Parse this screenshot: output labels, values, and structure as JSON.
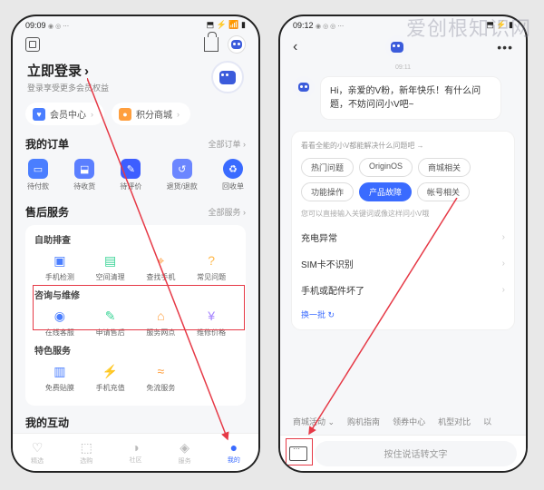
{
  "watermark": "爱创根知识网",
  "phone1": {
    "status": {
      "time": "09:09",
      "icons": "◉ ◎ ⋯",
      "right": "⬒ ⚡ 📶 ▮"
    },
    "login": {
      "title": "立即登录",
      "chevron": "›",
      "subtitle": "登录享受更多会员权益"
    },
    "chips": [
      {
        "icon": "♥",
        "label": "会员中心",
        "chev": "›"
      },
      {
        "icon": "●",
        "label": "积分商城",
        "chev": "›"
      }
    ],
    "orders": {
      "title": "我的订单",
      "link": "全部订单 ›",
      "items": [
        {
          "label": "待付款"
        },
        {
          "label": "待收货"
        },
        {
          "label": "待评价"
        },
        {
          "label": "退货/退款"
        },
        {
          "label": "回收单"
        }
      ]
    },
    "aftersale": {
      "title": "售后服务",
      "link": "全部服务 ›",
      "group1": {
        "title": "自助排查",
        "items": [
          {
            "label": "手机检测"
          },
          {
            "label": "空间清理"
          },
          {
            "label": "查找手机"
          },
          {
            "label": "常见问题"
          }
        ]
      },
      "group2": {
        "title": "咨询与维修",
        "items": [
          {
            "label": "在线客服"
          },
          {
            "label": "申请售后"
          },
          {
            "label": "服务网点"
          },
          {
            "label": "维修价格"
          }
        ]
      },
      "group3": {
        "title": "特色服务",
        "items": [
          {
            "label": "免费贴膜"
          },
          {
            "label": "手机充值"
          },
          {
            "label": "免流服务"
          }
        ]
      }
    },
    "interact": {
      "title": "我的互动"
    },
    "tabs": [
      {
        "label": "精选"
      },
      {
        "label": "选购"
      },
      {
        "label": "社区"
      },
      {
        "label": "服务"
      },
      {
        "label": "我的"
      }
    ]
  },
  "phone2": {
    "status": {
      "time": "09:12",
      "icons": "◉ ◎ ◎ ⋯",
      "right": "⬒ ⚡ ▮"
    },
    "timestamp": "09:11",
    "greeting": "Hi，亲爱的V粉，新年快乐！有什么问题，不妨问问小V吧~",
    "faq": {
      "hint": "看看全能的小V都能解决什么问题吧 →",
      "tags": [
        {
          "label": "热门问题",
          "active": false
        },
        {
          "label": "OriginOS",
          "active": false
        },
        {
          "label": "商城相关",
          "active": false
        },
        {
          "label": "功能操作",
          "active": false
        },
        {
          "label": "产品故障",
          "active": true
        },
        {
          "label": "帐号相关",
          "active": false
        }
      ],
      "subhint": "您可以直接输入关键词或像这样问小V哦",
      "items": [
        "充电异常",
        "SIM卡不识别",
        "手机或配件坏了"
      ],
      "refresh": "换一批 ↻"
    },
    "quicklinks": [
      "商城活动 ⌄",
      "购机指南",
      "领券中心",
      "机型对比",
      "以"
    ],
    "input": {
      "placeholder": "按住说话转文字"
    }
  }
}
